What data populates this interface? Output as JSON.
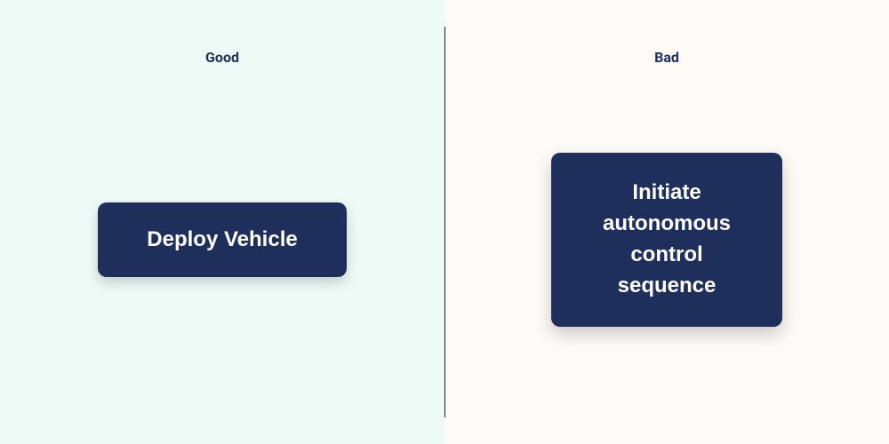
{
  "good": {
    "label": "Good",
    "button_label": "Deploy Vehicle"
  },
  "bad": {
    "label": "Bad",
    "button_label": "Initiate\nautonomous\ncontrol\nsequence"
  },
  "colors": {
    "button_bg": "#1f2f5b",
    "button_text": "#ffffff",
    "good_bg": "#eefaf6",
    "bad_bg": "#fdfaf7"
  }
}
